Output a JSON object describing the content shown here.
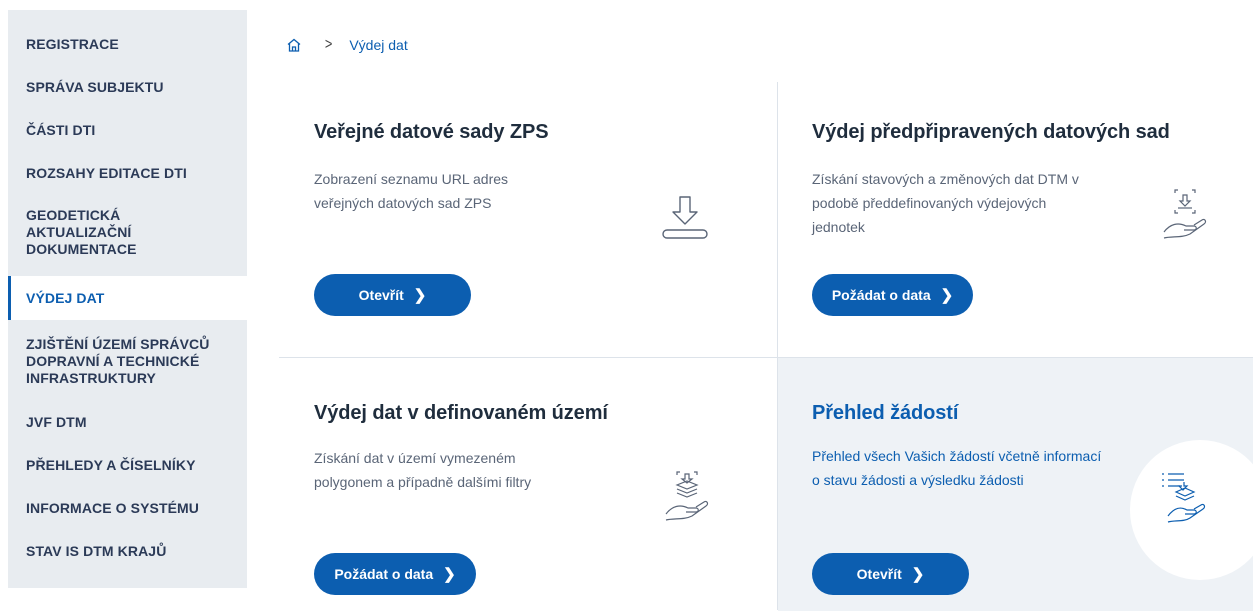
{
  "sidebar": {
    "items": [
      {
        "label": "REGISTRACE"
      },
      {
        "label": "SPRÁVA SUBJEKTU"
      },
      {
        "label": "ČÁSTI DTI"
      },
      {
        "label": "ROZSAHY EDITACE DTI"
      },
      {
        "label": "GEODETICKÁ AKTUALIZAČNÍ DOKUMENTACE"
      },
      {
        "label": "VÝDEJ DAT"
      },
      {
        "label": "ZJIŠTĚNÍ ÚZEMÍ SPRÁVCŮ DOPRAVNÍ A TECHNICKÉ INFRASTRUKTURY"
      },
      {
        "label": "JVF DTM"
      },
      {
        "label": "PŘEHLEDY A ČÍSELNÍKY"
      },
      {
        "label": "INFORMACE O SYSTÉMU"
      },
      {
        "label": "STAV IS DTM KRAJŮ"
      }
    ],
    "active": "VÝDEJ DAT"
  },
  "breadcrumb": {
    "separator": ">",
    "current": "Výdej dat"
  },
  "cards": [
    {
      "title": "Veřejné datové sady ZPS",
      "description": "Zobrazení seznamu URL adres veřejných datových sad ZPS",
      "button": "Otevřít",
      "icon": "download-tray-icon"
    },
    {
      "title": "Výdej předpřipravených datových sad",
      "description": "Získání stavových a změnových dat DTM v podobě předdefinovaných výdejových jednotek",
      "button": "Požádat o data",
      "icon": "hand-download-icon"
    },
    {
      "title": "Výdej dat v definovaném území",
      "description": "Získání dat v území vymezeném polygonem a případně dalšími filtry",
      "button": "Požádat o data",
      "icon": "hand-layers-icon"
    },
    {
      "title": "Přehled žádostí",
      "description": "Přehled všech Vašich žádostí včetně informací o stavu žádosti a výsledku žádosti",
      "button": "Otevřít",
      "icon": "list-hand-icon"
    }
  ],
  "colors": {
    "accent": "#0c5eb0",
    "sidebar_bg": "#e8ecf0",
    "highlight_bg": "#eef2f6"
  }
}
